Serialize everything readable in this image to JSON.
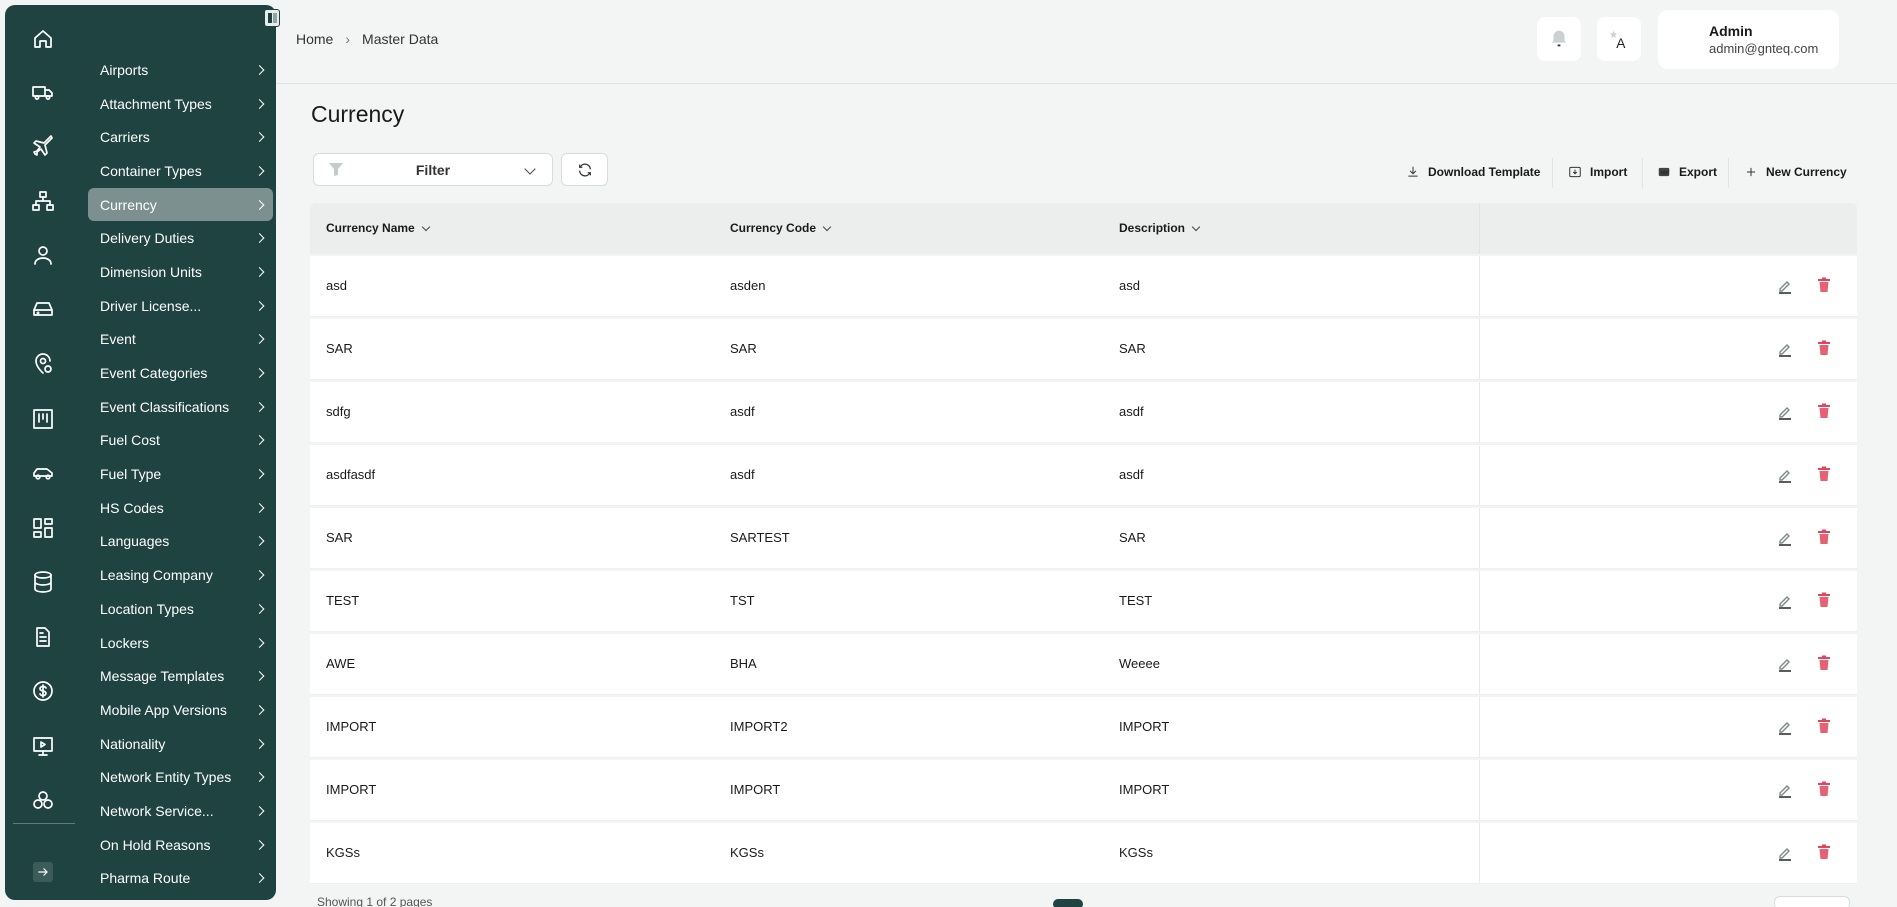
{
  "sidebar": {
    "rail_icons": [
      "home-icon",
      "truck-icon",
      "airplane-icon",
      "network-icon",
      "user-icon",
      "hard-drive-icon",
      "location-settings-icon",
      "kanban-board-icon",
      "car-icon",
      "dashboard-grid-icon",
      "database-icon",
      "document-icon",
      "dollar-icon",
      "monitor-icon",
      "hub-icon"
    ],
    "items": [
      {
        "label": "Airports"
      },
      {
        "label": "Attachment Types"
      },
      {
        "label": "Carriers"
      },
      {
        "label": "Container Types"
      },
      {
        "label": "Currency",
        "active": true
      },
      {
        "label": "Delivery Duties"
      },
      {
        "label": "Dimension Units"
      },
      {
        "label": "Driver License..."
      },
      {
        "label": "Event"
      },
      {
        "label": "Event Categories"
      },
      {
        "label": "Event Classifications"
      },
      {
        "label": "Fuel Cost"
      },
      {
        "label": "Fuel Type"
      },
      {
        "label": "HS Codes"
      },
      {
        "label": "Languages"
      },
      {
        "label": "Leasing Company"
      },
      {
        "label": "Location Types"
      },
      {
        "label": "Lockers"
      },
      {
        "label": "Message Templates"
      },
      {
        "label": "Mobile App Versions"
      },
      {
        "label": "Nationality"
      },
      {
        "label": "Network Entity Types"
      },
      {
        "label": "Network Service..."
      },
      {
        "label": "On Hold Reasons"
      },
      {
        "label": "Pharma Route"
      }
    ]
  },
  "header": {
    "breadcrumb": {
      "home": "Home",
      "separator": "›",
      "current": "Master Data"
    },
    "user": {
      "name": "Admin",
      "email": "admin@gnteq.com"
    }
  },
  "page": {
    "title": "Currency",
    "filter_label": "Filter",
    "actions": {
      "download_template": "Download Template",
      "import": "Import",
      "export": "Export",
      "new_currency": "New Currency"
    }
  },
  "table": {
    "columns": [
      "Currency Name",
      "Currency Code",
      "Description"
    ],
    "rows": [
      {
        "name": "asd",
        "code": "asden",
        "description": "asd"
      },
      {
        "name": "SAR",
        "code": "SAR",
        "description": "SAR"
      },
      {
        "name": "sdfg",
        "code": "asdf",
        "description": "asdf"
      },
      {
        "name": "asdfasdf",
        "code": "asdf",
        "description": "asdf"
      },
      {
        "name": "SAR",
        "code": "SARTEST",
        "description": "SAR"
      },
      {
        "name": "TEST",
        "code": "TST",
        "description": "TEST"
      },
      {
        "name": "AWE",
        "code": "BHA",
        "description": "Weeee"
      },
      {
        "name": "IMPORT",
        "code": "IMPORT2",
        "description": "IMPORT"
      },
      {
        "name": "IMPORT",
        "code": "IMPORT",
        "description": "IMPORT"
      },
      {
        "name": "KGSs",
        "code": "KGSs",
        "description": "KGSs"
      }
    ],
    "footer": "Showing 1 of 2 pages"
  },
  "colors": {
    "sidebar": "#1e4340",
    "active_item": "#7b908f",
    "delete": "#e0455a"
  }
}
